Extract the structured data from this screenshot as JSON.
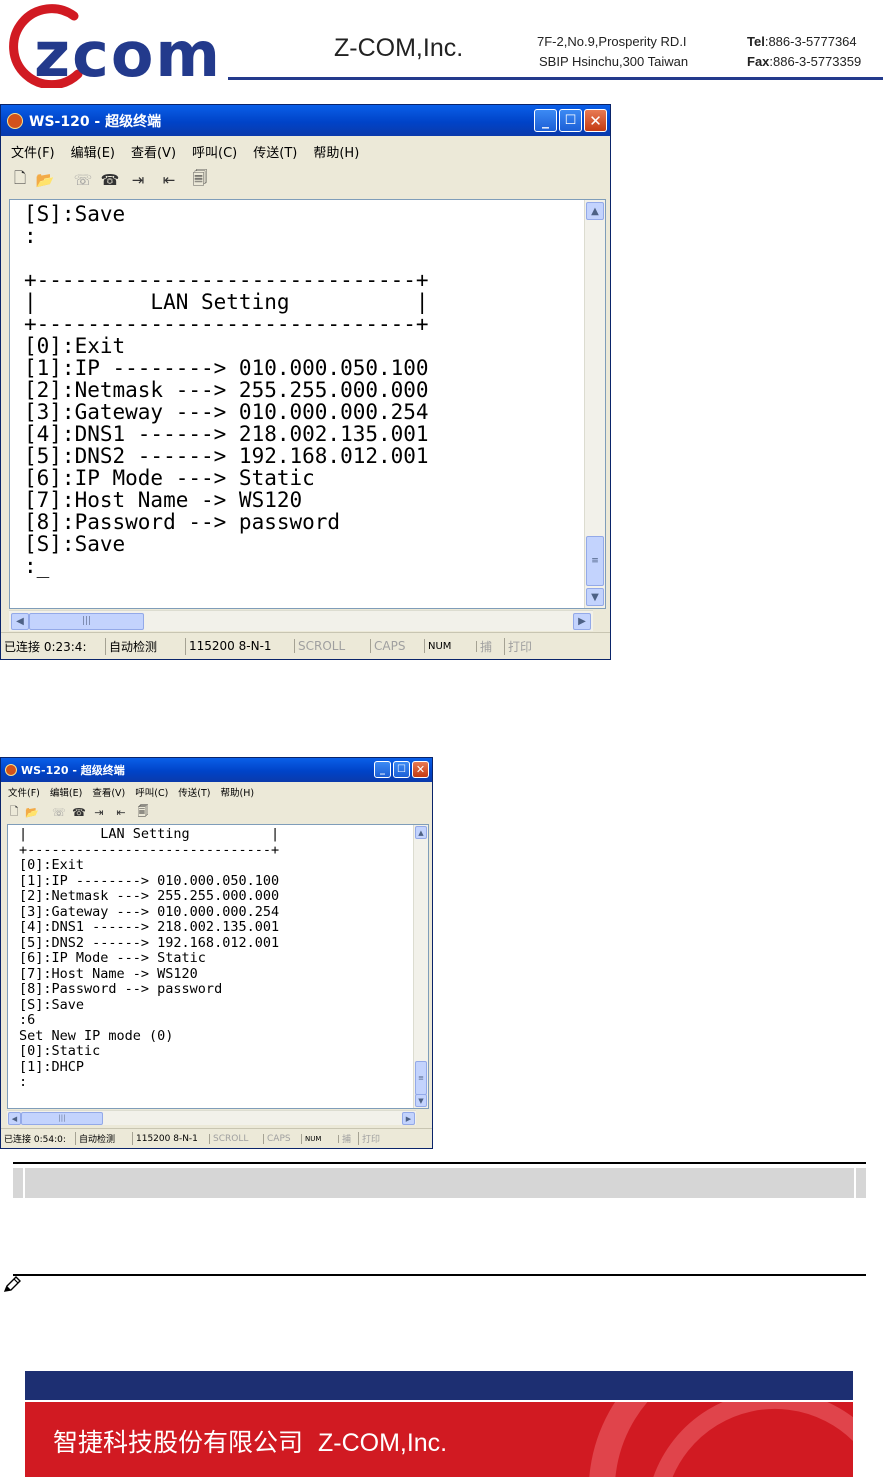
{
  "header": {
    "logo_text": "zcom",
    "company": "Z-COM,Inc.",
    "address_line1": "7F-2,No.9,Prosperity RD.I",
    "address_line2": "SBIP Hsinchu,300 Taiwan",
    "tel_label": "Tel",
    "tel_value": ":886-3-5777364",
    "fax_label": "Fax",
    "fax_value": ":886-3-5773359"
  },
  "window1": {
    "title": "WS-120 - 超级终端",
    "menu": [
      "文件(F)",
      "编辑(E)",
      "查看(V)",
      "呼叫(C)",
      "传送(T)",
      "帮助(H)"
    ],
    "terminal_lines": [
      "[S]:Save",
      ":",
      "",
      "+------------------------------+",
      "|         LAN Setting          |",
      "+------------------------------+",
      "[0]:Exit",
      "[1]:IP --------> 010.000.050.100",
      "[2]:Netmask ---> 255.255.000.000",
      "[3]:Gateway ---> 010.000.000.254",
      "[4]:DNS1 ------> 218.002.135.001",
      "[5]:DNS2 ------> 192.168.012.001",
      "[6]:IP Mode ---> Static",
      "[7]:Host Name -> WS120",
      "[8]:Password --> password",
      "[S]:Save",
      ":_"
    ],
    "status": {
      "connection": "已连接 0:23:4:",
      "detect": "自动检测",
      "baud": "115200 8-N-1",
      "scroll": "SCROLL",
      "caps": "CAPS",
      "num": "NUM",
      "capture": "捕",
      "print": "打印"
    }
  },
  "window2": {
    "title": "WS-120 - 超级终端",
    "menu": [
      "文件(F)",
      "编辑(E)",
      "查看(V)",
      "呼叫(C)",
      "传送(T)",
      "帮助(H)"
    ],
    "terminal_lines": [
      "|         LAN Setting          |",
      "+------------------------------+",
      "[0]:Exit",
      "[1]:IP --------> 010.000.050.100",
      "[2]:Netmask ---> 255.255.000.000",
      "[3]:Gateway ---> 010.000.000.254",
      "[4]:DNS1 ------> 218.002.135.001",
      "[5]:DNS2 ------> 192.168.012.001",
      "[6]:IP Mode ---> Static",
      "[7]:Host Name -> WS120",
      "[8]:Password --> password",
      "[S]:Save",
      ":6",
      "Set New IP mode (0)",
      "[0]:Static",
      "[1]:DHCP",
      ":"
    ],
    "status": {
      "connection": "已连接 0:54:0:",
      "detect": "自动检测",
      "baud": "115200 8-N-1",
      "scroll": "SCROLL",
      "caps": "CAPS",
      "num": "NUM",
      "capture": "捕",
      "print": "打印"
    }
  },
  "footer": {
    "chinese_name": "智捷科技股份有限公司",
    "english_name": "Z-COM,Inc."
  },
  "colors": {
    "brand_blue": "#233a8c",
    "footer_blue": "#1d2f72",
    "footer_red": "#d11a22",
    "xp_title": "#0a5fe8"
  }
}
